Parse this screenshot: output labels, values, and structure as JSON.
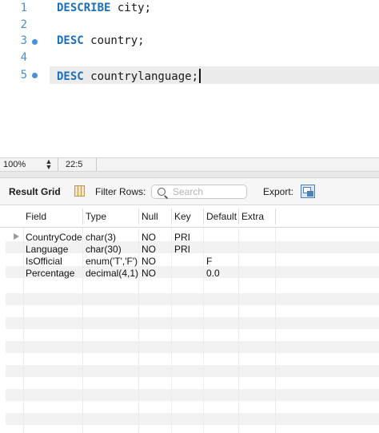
{
  "editor": {
    "lines": [
      {
        "num": "1",
        "keyword": "DESCRIBE",
        "rest": " city;",
        "dot": false
      },
      {
        "num": "2",
        "keyword": "",
        "rest": "",
        "dot": false
      },
      {
        "num": "3",
        "keyword": "DESC",
        "rest": " country;",
        "dot": true
      },
      {
        "num": "4",
        "keyword": "",
        "rest": "",
        "dot": false
      },
      {
        "num": "5",
        "keyword": "DESC",
        "rest": " countrylanguage;",
        "dot": true
      }
    ]
  },
  "status": {
    "zoom": "100%",
    "cursor": "22:5"
  },
  "toolbar": {
    "result_grid": "Result Grid",
    "filter_rows": "Filter Rows:",
    "search_placeholder": "Search",
    "export": "Export:"
  },
  "grid": {
    "columns": [
      "Field",
      "Type",
      "Null",
      "Key",
      "Default",
      "Extra"
    ],
    "rows": [
      [
        "CountryCode",
        "char(3)",
        "NO",
        "PRI",
        "",
        ""
      ],
      [
        "Language",
        "char(30)",
        "NO",
        "PRI",
        "",
        ""
      ],
      [
        "IsOfficial",
        "enum('T','F')",
        "NO",
        "",
        "F",
        ""
      ],
      [
        "Percentage",
        "decimal(4,1)",
        "NO",
        "",
        "0.0",
        ""
      ]
    ]
  },
  "icons": {
    "grid": "result-grid-icon",
    "search": "search-icon",
    "export": "export-icon",
    "row_pointer": "row-pointer-icon",
    "breakpoint": "line-marker-dot",
    "zoom_stepper": "chevron-updown-icon"
  },
  "colors": {
    "keyword": "#1f6fb5",
    "line_number": "#4a8fc9",
    "current_line": "#ececec",
    "stripe": "#f2f2f2"
  }
}
